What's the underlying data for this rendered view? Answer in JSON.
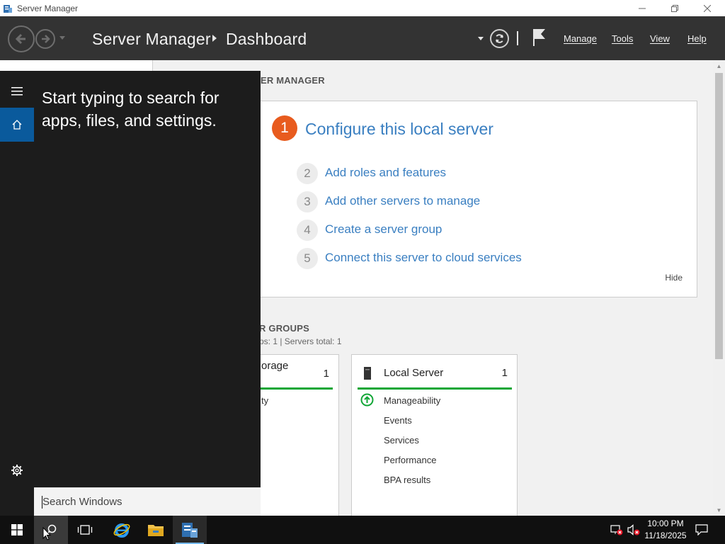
{
  "window": {
    "title": "Server Manager",
    "minimize_label": "—",
    "restore_label": "❐",
    "close_label": "✕"
  },
  "header": {
    "app": "Server Manager",
    "page": "Dashboard",
    "menu": {
      "manage": "Manage",
      "tools": "Tools",
      "view": "View",
      "help": "Help"
    }
  },
  "welcome": {
    "section_title": "ER MANAGER",
    "step1": {
      "num": "1",
      "label": "Configure this local server"
    },
    "steps": [
      {
        "num": "2",
        "label": "Add roles and features"
      },
      {
        "num": "3",
        "label": "Add other servers to manage"
      },
      {
        "num": "4",
        "label": "Create a server group"
      },
      {
        "num": "5",
        "label": "Connect this server to cloud services"
      }
    ],
    "hide": "Hide"
  },
  "groups": {
    "section_title": "R GROUPS",
    "subtitle": "ps: 1   |   Servers total: 1",
    "tiles": [
      {
        "title": "orage",
        "count": "1",
        "items": [
          "ty"
        ]
      },
      {
        "title": "Local Server",
        "count": "1",
        "items": [
          "Manageability",
          "Events",
          "Services",
          "Performance",
          "BPA results"
        ]
      }
    ]
  },
  "start": {
    "hint": "Start typing to search for apps, files, and settings.",
    "search_placeholder": "Search Windows"
  },
  "taskbar": {
    "time": "10:00 PM",
    "date": "11/18/2025"
  },
  "colors": {
    "accent_blue": "#3a7fc1",
    "step_orange": "#e85b1e",
    "status_green": "#11a636",
    "header_bg": "#333333",
    "start_bg": "#1c1c1c",
    "home_blue": "#0a5a9c"
  }
}
